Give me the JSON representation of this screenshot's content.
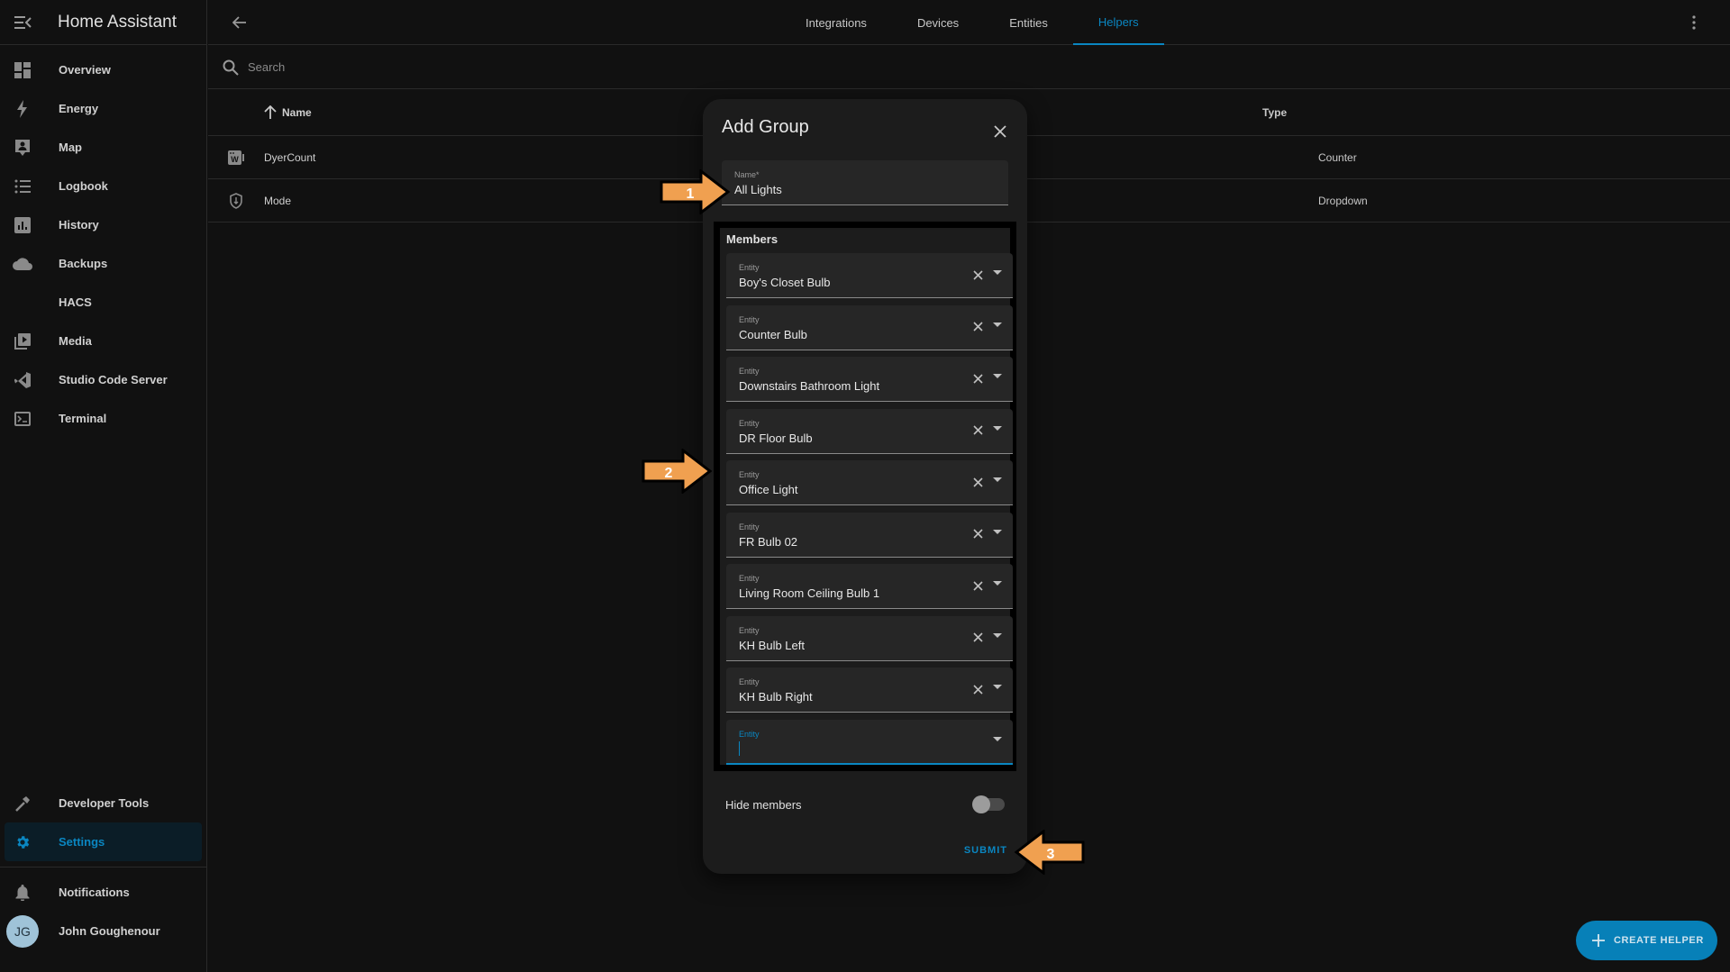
{
  "app": {
    "title": "Home Assistant"
  },
  "sidebar": {
    "items": [
      {
        "label": "Overview",
        "icon": "view-dashboard-icon"
      },
      {
        "label": "Energy",
        "icon": "lightning-bolt-icon"
      },
      {
        "label": "Map",
        "icon": "map-account-icon"
      },
      {
        "label": "Logbook",
        "icon": "format-list-bulleted-icon"
      },
      {
        "label": "History",
        "icon": "chart-box-icon"
      },
      {
        "label": "Backups",
        "icon": "cloud-icon"
      },
      {
        "label": "HACS",
        "icon": ""
      },
      {
        "label": "Media",
        "icon": "play-box-multiple-icon"
      },
      {
        "label": "Studio Code Server",
        "icon": "vscode-icon"
      },
      {
        "label": "Terminal",
        "icon": "console-icon"
      }
    ],
    "developer_tools": "Developer Tools",
    "settings": "Settings",
    "notifications": "Notifications",
    "user": {
      "name": "John Goughenour",
      "initials": "JG"
    }
  },
  "topbar": {
    "tabs": [
      {
        "label": "Integrations",
        "active": false
      },
      {
        "label": "Devices",
        "active": false
      },
      {
        "label": "Entities",
        "active": false
      },
      {
        "label": "Helpers",
        "active": true
      }
    ]
  },
  "search": {
    "placeholder": "Search",
    "value": ""
  },
  "table": {
    "columns": {
      "name": "Name",
      "type": "Type"
    },
    "rows": [
      {
        "name": "DyerCount",
        "type": "Counter",
        "icon": "counter-icon"
      },
      {
        "name": "Mode",
        "type": "Dropdown",
        "icon": "shield-icon"
      }
    ]
  },
  "dialog": {
    "title": "Add Group",
    "name_field": {
      "label": "Name*",
      "value": "All Lights"
    },
    "members_title": "Members",
    "entity_label": "Entity",
    "members": [
      "Boy's Closet Bulb",
      "Counter Bulb",
      "Downstairs Bathroom Light",
      "DR Floor Bulb",
      "Office Light",
      "FR Bulb 02",
      "Living Room Ceiling Bulb 1",
      "KH Bulb Left",
      "KH Bulb Right"
    ],
    "new_member": {
      "label": "Entity",
      "value": ""
    },
    "hide_members": {
      "label": "Hide members",
      "on": false
    },
    "submit": "SUBMIT"
  },
  "annotations": [
    {
      "label": "1",
      "color": "#f0a050"
    },
    {
      "label": "2",
      "color": "#f0a050"
    },
    {
      "label": "3",
      "color": "#f0a050"
    }
  ],
  "fab": {
    "label": "CREATE HELPER"
  },
  "colors": {
    "accent": "#0a86c1",
    "background": "#111111",
    "dialog": "#1c1c1c",
    "callout": "#f0a050"
  }
}
